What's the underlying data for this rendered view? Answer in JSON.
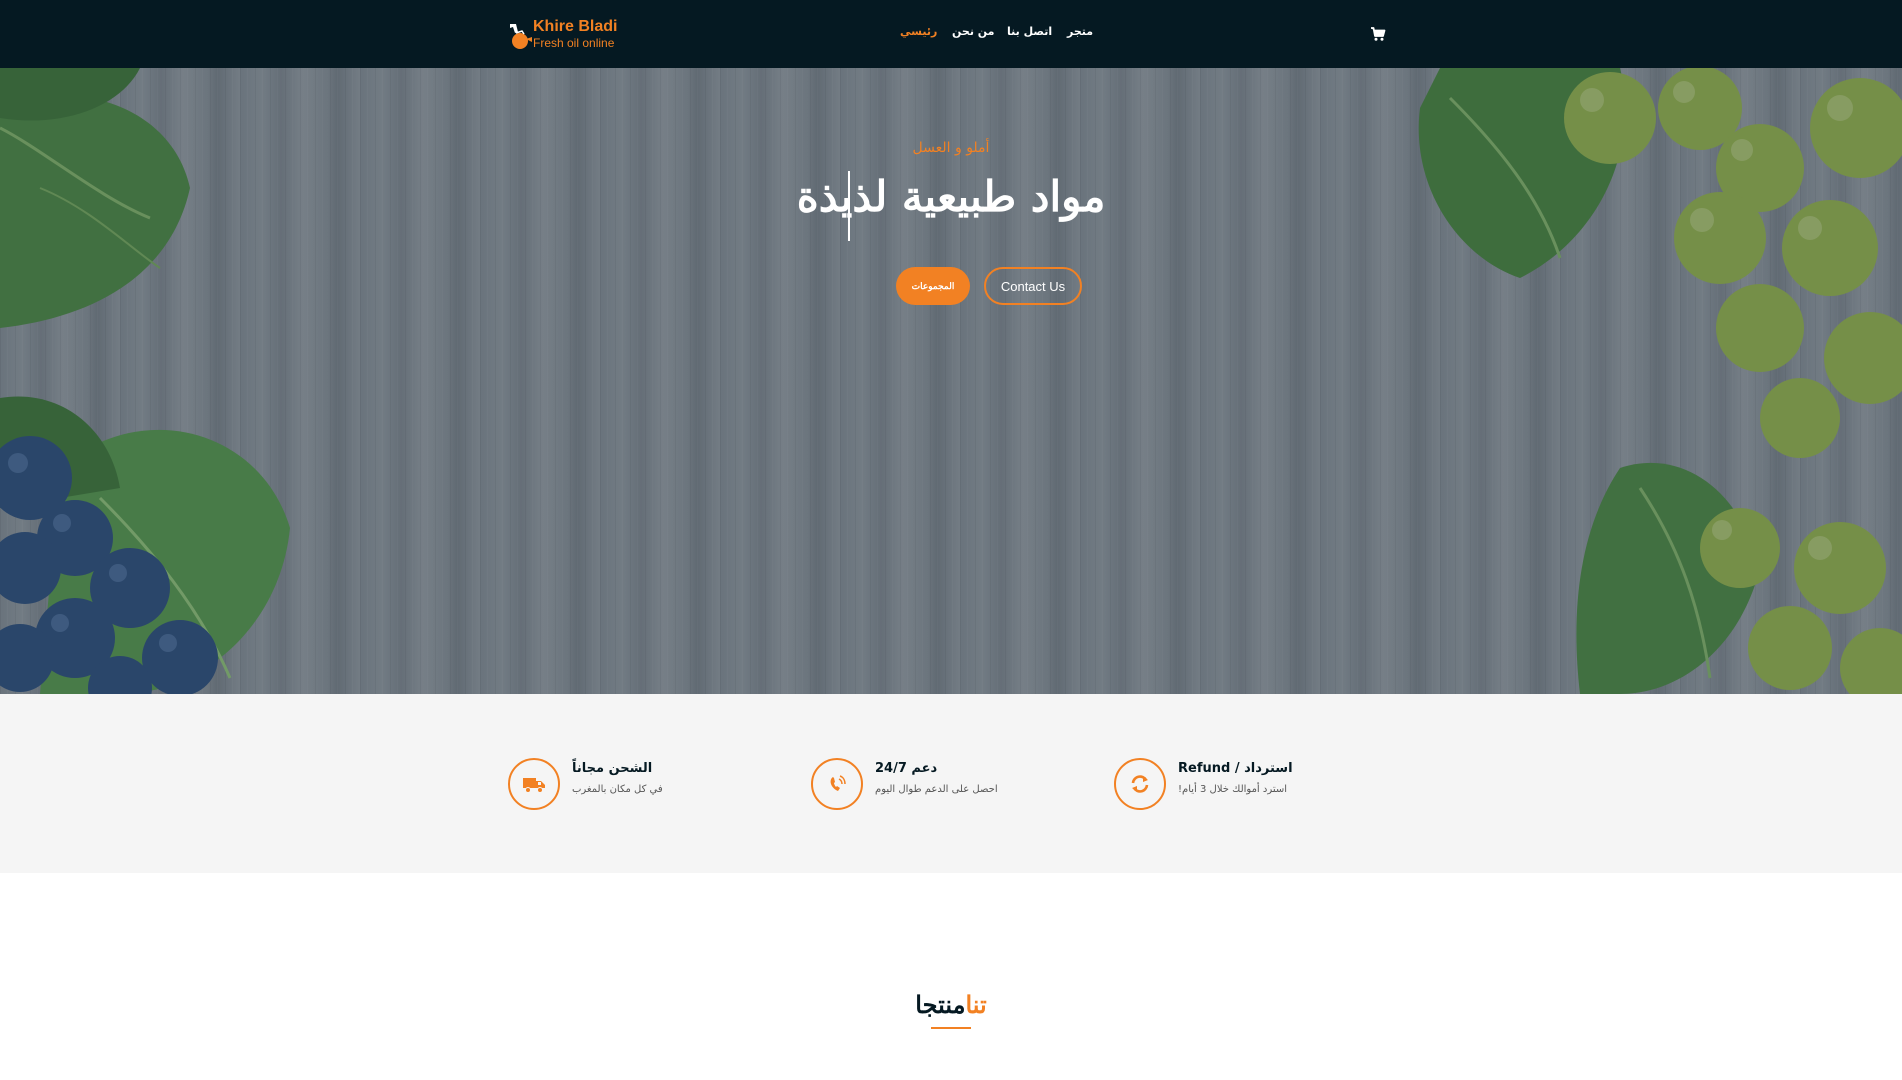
{
  "brand": {
    "title": "Khire Bladi",
    "subtitle": "Fresh oil online"
  },
  "nav": {
    "items": [
      {
        "label": "رئيسي",
        "active": true
      },
      {
        "label": "من نحن",
        "active": false
      },
      {
        "label": "اتصل بنا",
        "active": false
      },
      {
        "label": "متجر",
        "active": false
      }
    ],
    "cart_icon": "shopping-cart-icon"
  },
  "hero": {
    "subtitle": "أملو و العسل",
    "title": "مواد طبيعية لذيذة",
    "collections_button": "المجموعات",
    "contact_button": "Contact Us"
  },
  "features": [
    {
      "icon": "truck-icon",
      "title": "الشحن مجاناً",
      "desc": "في كل مكان بالمغرب"
    },
    {
      "icon": "phone-volume-icon",
      "title": "24/7 دعم",
      "desc": "احصل على الدعم طوال اليوم"
    },
    {
      "icon": "refund-sync-icon",
      "title": "Refund / استرداد",
      "desc": "!استرد أموالك خلال 3 أيام"
    }
  ],
  "products": {
    "title_part1": "منتجا",
    "title_part2": "تنا"
  },
  "colors": {
    "accent": "#F28123",
    "navbar": "#051922",
    "features_bg": "#f5f5f5"
  }
}
